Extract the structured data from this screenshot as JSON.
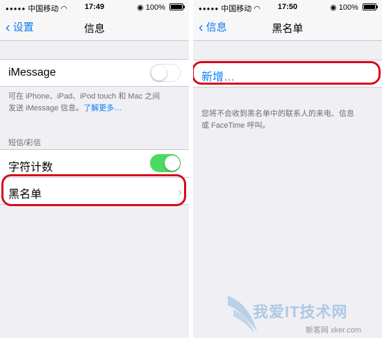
{
  "left": {
    "status": {
      "carrier": "中国移动",
      "time": "17:49",
      "battery": "100%"
    },
    "nav": {
      "back_label": "设置",
      "title": "信息"
    },
    "imessage": {
      "label": "iMessage",
      "description_line1": "可在 iPhone、iPad、iPod touch 和 Mac 之间",
      "description_line2": "发送 iMessage 信息。",
      "learn_more": "了解更多…"
    },
    "sms_section": {
      "header": "短信/彩信",
      "char_count_label": "字符计数",
      "blacklist_label": "黑名单"
    }
  },
  "right": {
    "status": {
      "carrier": "中国移动",
      "time": "17:50",
      "battery": "100%"
    },
    "nav": {
      "back_label": "信息",
      "title": "黑名单"
    },
    "add_new_label": "新增…",
    "footnote_line1": "您将不会收到黑名单中的联系人的来电、信息",
    "footnote_line2": "或 FaceTime 呼叫。"
  },
  "watermark": {
    "text": "我爱IT技术网",
    "sub": "新客网 xker.com"
  },
  "colors": {
    "accent": "#0a7cf6",
    "toggle_on": "#4cd964",
    "highlight": "#d4091a",
    "grouped_bg": "#efeff4"
  }
}
